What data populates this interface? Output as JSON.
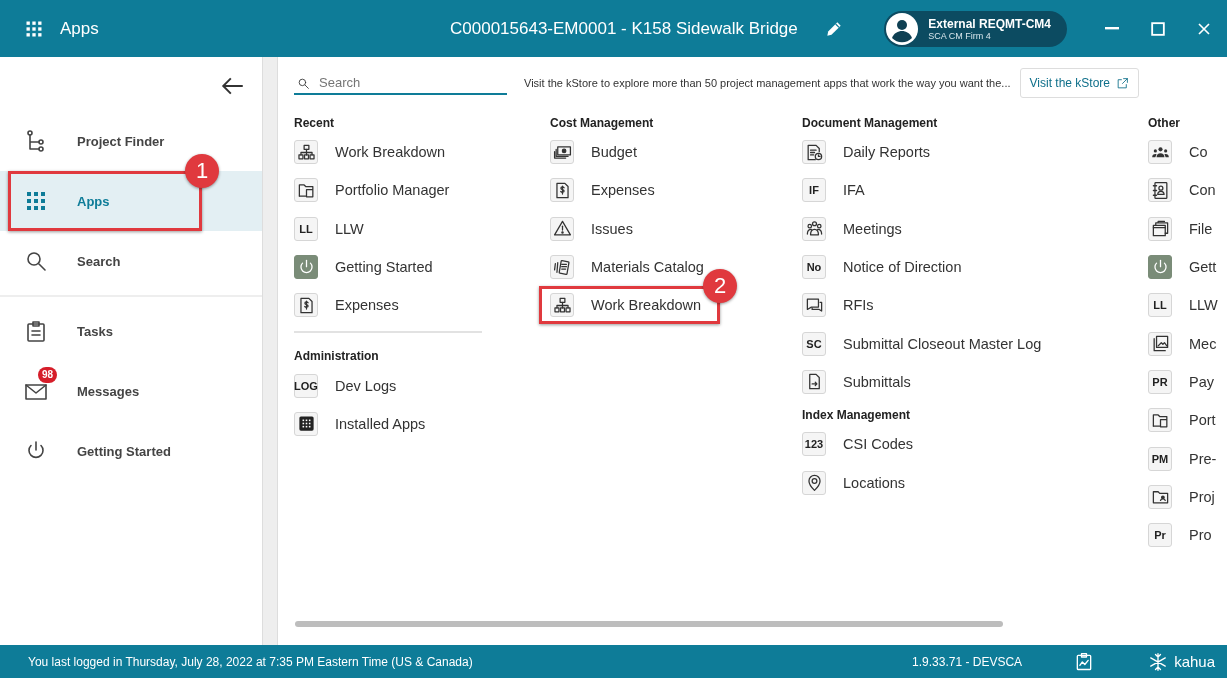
{
  "header": {
    "app_label": "Apps",
    "title": "C000015643-EM0001 - K158 Sidewalk Bridge",
    "user": {
      "name": "External REQMT-CM4",
      "company": "SCA CM Firm 4"
    }
  },
  "sidebar": {
    "items": [
      {
        "label": "Project Finder",
        "selected": false
      },
      {
        "label": "Apps",
        "selected": true,
        "callout": "1"
      },
      {
        "label": "Search",
        "selected": false,
        "divider_after": true
      },
      {
        "label": "Tasks",
        "selected": false
      },
      {
        "label": "Messages",
        "selected": false,
        "badge": "98"
      },
      {
        "label": "Getting Started",
        "selected": false
      }
    ]
  },
  "toolbar": {
    "search": {
      "placeholder": "Search"
    },
    "promo": "Visit the kStore to explore more than 50 project management apps that work the way you want the...",
    "store_button": "Visit the kStore"
  },
  "columns": [
    {
      "sections": [
        {
          "title": "Recent",
          "divider_after": true,
          "items": [
            {
              "label": "Work Breakdown",
              "kind": "glyph"
            },
            {
              "label": "Portfolio Manager",
              "kind": "glyph"
            },
            {
              "label": "LLW",
              "kind": "badge",
              "badge": "LL"
            },
            {
              "label": "Getting Started",
              "kind": "power"
            },
            {
              "label": "Expenses",
              "kind": "glyph"
            }
          ]
        },
        {
          "title": "Administration",
          "items": [
            {
              "label": "Dev Logs",
              "kind": "badge",
              "badge": "LOG"
            },
            {
              "label": "Installed Apps",
              "kind": "glyph"
            }
          ]
        }
      ]
    },
    {
      "sections": [
        {
          "title": "Cost Management",
          "items": [
            {
              "label": "Budget",
              "kind": "glyph"
            },
            {
              "label": "Expenses",
              "kind": "glyph"
            },
            {
              "label": "Issues",
              "kind": "glyph"
            },
            {
              "label": "Materials Catalog",
              "kind": "glyph"
            },
            {
              "label": "Work Breakdown",
              "kind": "glyph",
              "callout": "2"
            }
          ]
        }
      ]
    },
    {
      "sections": [
        {
          "title": "Document Management",
          "items": [
            {
              "label": "Daily Reports",
              "kind": "glyph"
            },
            {
              "label": "IFA",
              "kind": "badge",
              "badge": "IF"
            },
            {
              "label": "Meetings",
              "kind": "glyph"
            },
            {
              "label": "Notice of Direction",
              "kind": "badge",
              "badge": "No"
            },
            {
              "label": "RFIs",
              "kind": "glyph"
            },
            {
              "label": "Submittal Closeout Master Log",
              "kind": "badge",
              "badge": "SC"
            },
            {
              "label": "Submittals",
              "kind": "glyph"
            }
          ]
        },
        {
          "title": "Index Management",
          "items": [
            {
              "label": "CSI Codes",
              "kind": "badge",
              "badge": "123"
            },
            {
              "label": "Locations",
              "kind": "glyph"
            }
          ]
        }
      ]
    },
    {
      "sections": [
        {
          "title": "Other",
          "items": [
            {
              "label": "Co",
              "kind": "glyph"
            },
            {
              "label": "Con",
              "kind": "glyph"
            },
            {
              "label": "File",
              "kind": "glyph"
            },
            {
              "label": "Gett",
              "kind": "power"
            },
            {
              "label": "LLW",
              "kind": "badge",
              "badge": "LL"
            },
            {
              "label": "Mec",
              "kind": "glyph"
            },
            {
              "label": "Pay",
              "kind": "badge",
              "badge": "PR"
            },
            {
              "label": "Port",
              "kind": "glyph"
            },
            {
              "label": "Pre-",
              "kind": "badge",
              "badge": "PM"
            },
            {
              "label": "Proj",
              "kind": "glyph"
            },
            {
              "label": "Pro",
              "kind": "badge",
              "badge": "Pr"
            }
          ]
        }
      ]
    }
  ],
  "status_bar": {
    "last_login": "You last logged in Thursday, July 28, 2022 at 7:35 PM Eastern Time (US & Canada)",
    "version": "1.9.33.71 - DEVSCA",
    "brand": "kahua"
  }
}
